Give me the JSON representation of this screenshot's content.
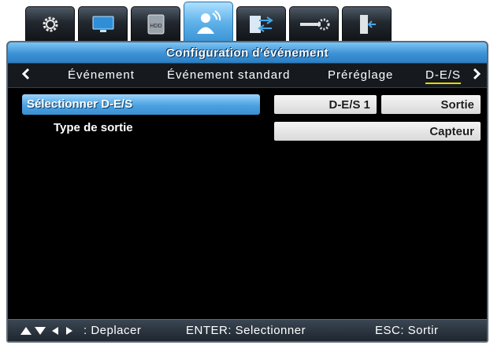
{
  "top_tabs": [
    {
      "icon": "gear-icon",
      "active": false
    },
    {
      "icon": "monitor-icon",
      "active": false
    },
    {
      "icon": "hdd-icon",
      "active": false,
      "label": "HDD"
    },
    {
      "icon": "user-signal-icon",
      "active": true
    },
    {
      "icon": "network-transfer-icon",
      "active": false
    },
    {
      "icon": "system-settings-icon",
      "active": false
    },
    {
      "icon": "exit-icon",
      "active": false
    }
  ],
  "title": "Configuration d'événement",
  "sub_tabs": [
    "Événement",
    "Événement standard",
    "Préréglage",
    "D-E/S"
  ],
  "rows": {
    "select_label": "Sélectionner D-E/S",
    "select_value": "D-E/S 1",
    "select_mode": "Sortie",
    "output_type_label": "Type de sortie",
    "output_type_value": "Capteur"
  },
  "footer": {
    "move": ": Deplacer",
    "enter": "ENTER: Selectionner",
    "esc": "ESC: Sortir"
  },
  "colors": {
    "accent": "#3d92d6",
    "highlight": "#e8d800",
    "panel_bg": "#000000"
  }
}
